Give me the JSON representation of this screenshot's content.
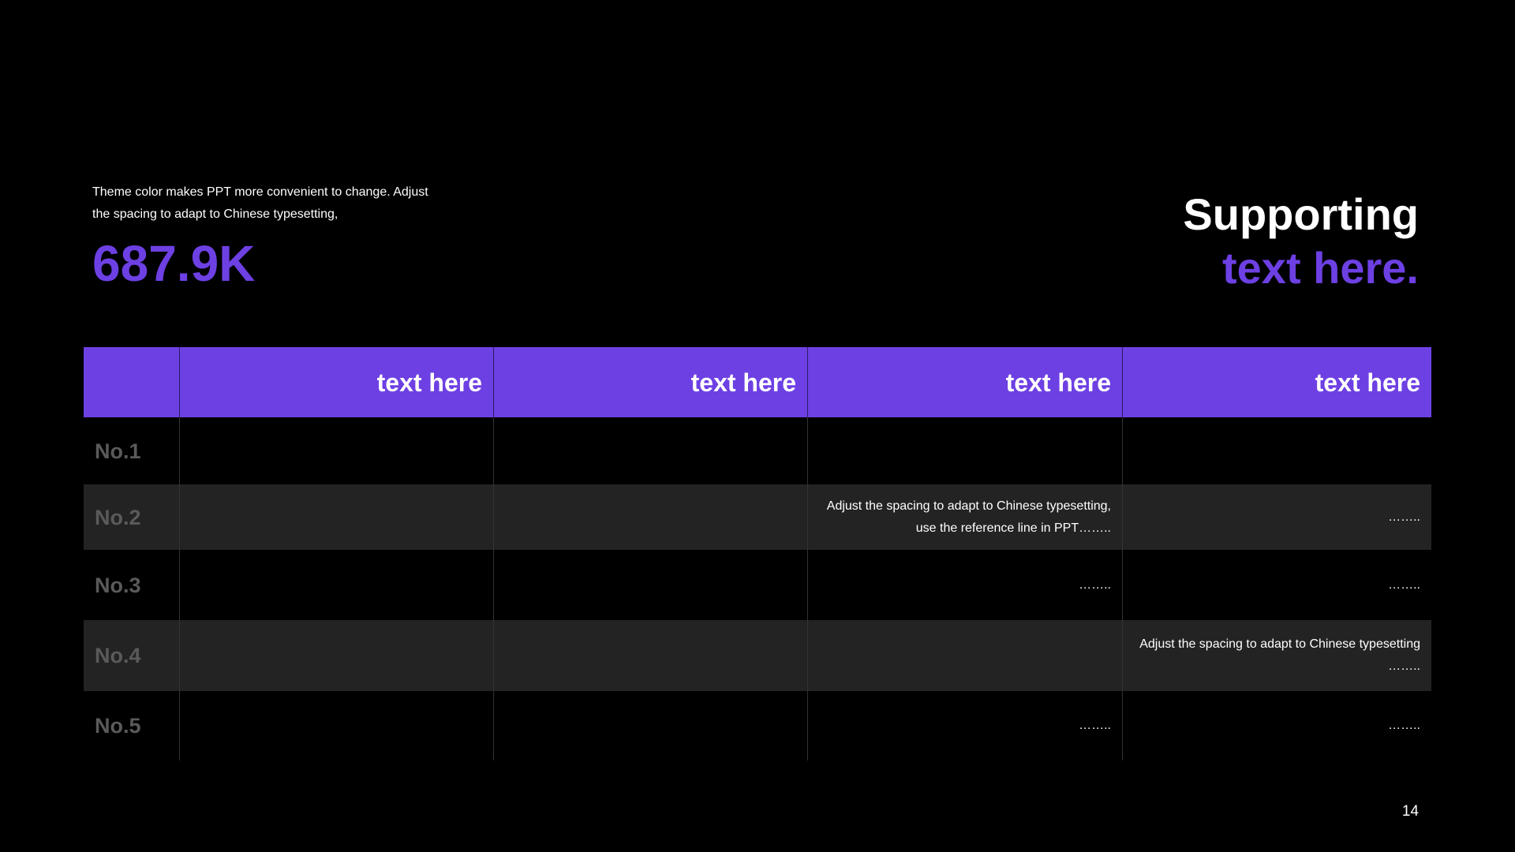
{
  "intro": {
    "line1": "Theme  color makes PPT more convenient  to change.  Adjust",
    "line2": "the spacing to adapt to Chinese typesetting,"
  },
  "stat": {
    "value": "687.9K"
  },
  "headline": {
    "line1": "Supporting",
    "line2": "text here."
  },
  "colors": {
    "accent": "#6d40e3",
    "background": "#000000",
    "shaded_row": "#232323",
    "row_label": "#5a5a5a"
  },
  "table": {
    "headers": [
      "",
      "text here",
      "text here",
      "text here",
      "text here"
    ],
    "rows": [
      {
        "label": "No.1",
        "cells": [
          "",
          "",
          "",
          ""
        ]
      },
      {
        "label": "No.2",
        "cells": [
          "",
          "",
          "Adjust the spacing to adapt to Chinese typesetting,|use the reference line in PPT……..",
          "…….."
        ]
      },
      {
        "label": "No.3",
        "cells": [
          "",
          "",
          "……..",
          "…….."
        ]
      },
      {
        "label": "No.4",
        "cells": [
          "",
          "",
          "",
          "Adjust the spacing to adapt to Chinese typesetting|…….."
        ]
      },
      {
        "label": "No.5",
        "cells": [
          "",
          "",
          "……..",
          "…….."
        ]
      }
    ],
    "row2_col3_line1": "Adjust the spacing to adapt to Chinese typesetting,",
    "row2_col3_line2": "use the reference line in PPT……..",
    "row4_col4_line1": "Adjust the spacing to adapt to Chinese typesetting",
    "row4_col4_line2": "……..",
    "ellipsis": "…….."
  },
  "page_number": "14"
}
